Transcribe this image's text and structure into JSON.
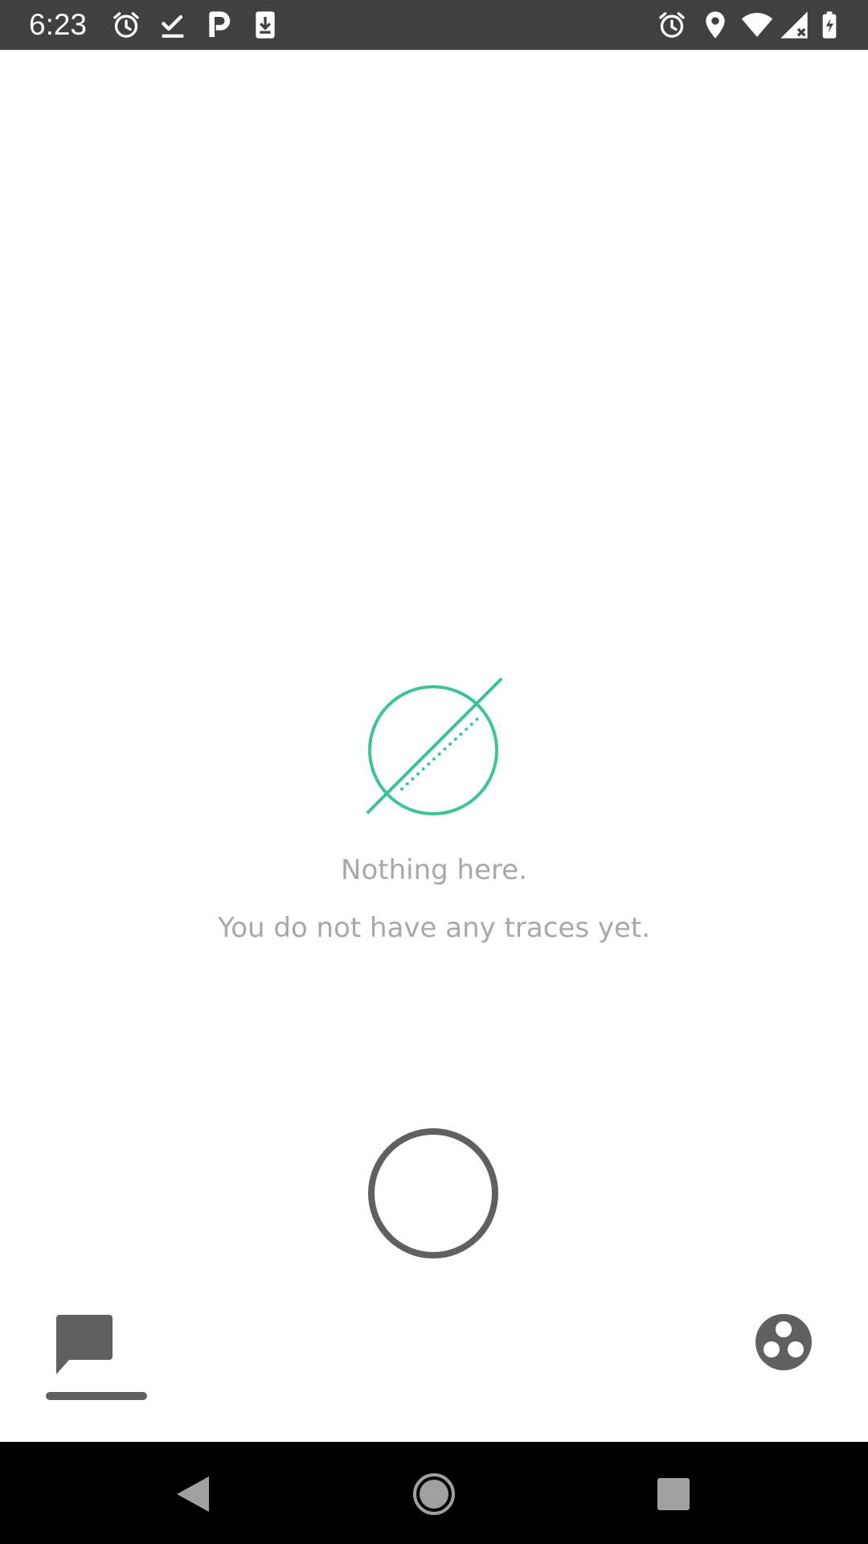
{
  "status_bar": {
    "time": "6:23",
    "icons_left": [
      "alarm-icon",
      "check-icon",
      "parking-icon",
      "download-icon"
    ],
    "icons_right": [
      "alarm-icon",
      "location-icon",
      "wifi-icon",
      "signal-icon",
      "battery-icon"
    ]
  },
  "empty_state": {
    "icon": "empty-set-icon",
    "title": "Nothing here.",
    "subtitle": "You do not have any traces yet."
  },
  "record_button": {
    "icon": "record-circle-icon"
  },
  "bottom_tabs": {
    "left_icon": "chat-bubble-icon",
    "right_icon": "three-dots-circle-icon"
  },
  "nav_bar": {
    "back_icon": "back-triangle-icon",
    "home_icon": "home-circle-icon",
    "recents_icon": "recents-square-icon"
  },
  "colors": {
    "status_bar_bg": "#404040",
    "accent_green": "#3cc497",
    "text_muted": "#a8a8a8",
    "icon_gray": "#606060",
    "nav_bar_bg": "#000000"
  }
}
